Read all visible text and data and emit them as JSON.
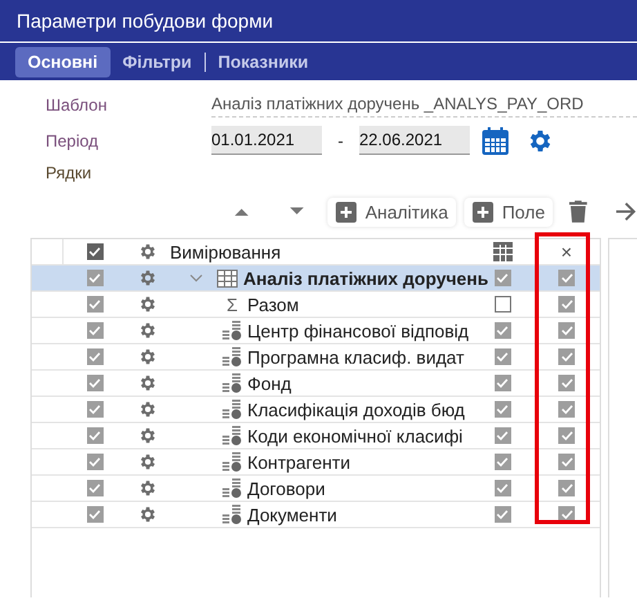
{
  "window": {
    "title": "Параметри побудови форми"
  },
  "tabs": [
    {
      "label": "Основні",
      "selected": true
    },
    {
      "label": "Фільтри",
      "selected": false
    },
    {
      "label": "Показники",
      "selected": false
    }
  ],
  "fields": {
    "template_label": "Шаблон",
    "template_value": "Аналіз платіжних доручень _ANALYS_PAY_ORD",
    "period_label": "Період",
    "date_from": "01.01.2021",
    "date_separator": "-",
    "date_to": "22.06.2021",
    "rows_label": "Рядки"
  },
  "toolbar": {
    "add_analytics": "Аналітика",
    "add_field": "Поле"
  },
  "table": {
    "header": {
      "name": "Вимірювання",
      "show_checked": true,
      "column_5_label": "×"
    },
    "rows": [
      {
        "kind": "group",
        "name": "Аналіз платіжних доручень",
        "selected": true,
        "checked": true,
        "column_4_checked": true,
        "column_5_checked": true
      },
      {
        "kind": "sum",
        "icon": "Σ",
        "name": "Разом",
        "selected": false,
        "checked": true,
        "column_4_checked": false,
        "column_5_checked": true
      },
      {
        "kind": "dimension",
        "name": "Центр фінансової відповід",
        "selected": false,
        "checked": true,
        "column_4_checked": true,
        "column_5_checked": true
      },
      {
        "kind": "dimension",
        "name": "Програмна класиф. видат",
        "selected": false,
        "checked": true,
        "column_4_checked": true,
        "column_5_checked": true
      },
      {
        "kind": "dimension",
        "name": "Фонд",
        "selected": false,
        "checked": true,
        "column_4_checked": true,
        "column_5_checked": true
      },
      {
        "kind": "dimension",
        "name": "Класифікація доходів бюд",
        "selected": false,
        "checked": true,
        "column_4_checked": true,
        "column_5_checked": true
      },
      {
        "kind": "dimension",
        "name": "Коди економічної класифі",
        "selected": false,
        "checked": true,
        "column_4_checked": true,
        "column_5_checked": true
      },
      {
        "kind": "dimension",
        "name": "Контрагенти",
        "selected": false,
        "checked": true,
        "column_4_checked": true,
        "column_5_checked": true
      },
      {
        "kind": "dimension",
        "name": "Договори",
        "selected": false,
        "checked": true,
        "column_4_checked": true,
        "column_5_checked": true
      },
      {
        "kind": "dimension",
        "name": "Документи",
        "selected": false,
        "checked": true,
        "column_4_checked": true,
        "column_5_checked": true
      }
    ]
  }
}
